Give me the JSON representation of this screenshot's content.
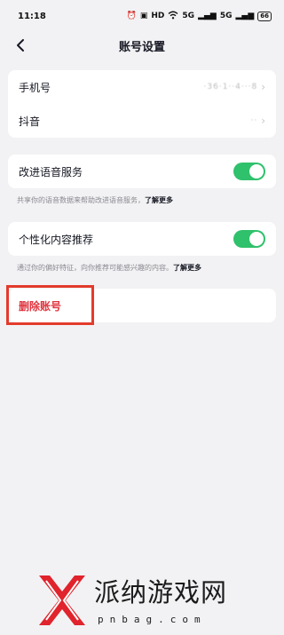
{
  "status_bar": {
    "time": "11:18",
    "icons": [
      "alarm-icon",
      "vibrate-icon",
      "hd-icon",
      "wifi-icon",
      "signal-icon",
      "signal-icon"
    ],
    "hd_label": "HD",
    "signal1_label": "5G",
    "signal2_label": "5G",
    "battery": "66"
  },
  "nav": {
    "title": "账号设置"
  },
  "account_card": {
    "phone_label": "手机号",
    "phone_value": "·36·1··4···8",
    "douyin_label": "抖音",
    "douyin_value": "··"
  },
  "voice": {
    "label": "改进语音服务",
    "enabled": true,
    "caption": "共享你的语音数据来帮助改进语音服务，",
    "more": "了解更多"
  },
  "recommend": {
    "label": "个性化内容推荐",
    "enabled": true,
    "caption": "通过你的偏好特征，向你推荐可能感兴趣的内容。",
    "more": "了解更多"
  },
  "delete": {
    "label": "删除账号"
  },
  "watermark": {
    "text": "派纳游戏网",
    "domain": "pnbag.com"
  },
  "colors": {
    "accent_green": "#2fc16b",
    "danger_red": "#e0343e",
    "highlight_red": "#e33b2c",
    "background": "#f2f2f4"
  }
}
